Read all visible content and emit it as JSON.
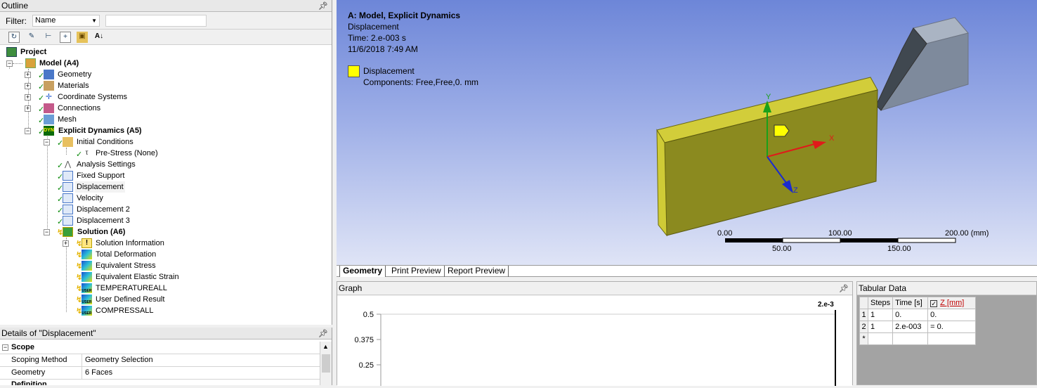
{
  "outline": {
    "title": "Outline",
    "filter_label": "Filter:",
    "filter_value": "Name",
    "filter_text": "",
    "tree": [
      {
        "label": "Project",
        "bold": true
      },
      {
        "label": "Model (A4)",
        "bold": true
      },
      {
        "label": "Geometry"
      },
      {
        "label": "Materials"
      },
      {
        "label": "Coordinate Systems"
      },
      {
        "label": "Connections"
      },
      {
        "label": "Mesh"
      },
      {
        "label": "Explicit Dynamics (A5)",
        "bold": true
      },
      {
        "label": "Initial Conditions"
      },
      {
        "label": "Pre-Stress (None)"
      },
      {
        "label": "Analysis Settings"
      },
      {
        "label": "Fixed Support"
      },
      {
        "label": "Displacement",
        "selected": true
      },
      {
        "label": "Velocity"
      },
      {
        "label": "Displacement 2"
      },
      {
        "label": "Displacement 3"
      },
      {
        "label": "Solution (A6)",
        "bold": true
      },
      {
        "label": "Solution Information"
      },
      {
        "label": "Total Deformation"
      },
      {
        "label": "Equivalent Stress"
      },
      {
        "label": "Equivalent Elastic Strain"
      },
      {
        "label": "TEMPERATUREALL"
      },
      {
        "label": "User Defined Result"
      },
      {
        "label": "COMPRESSALL"
      }
    ],
    "icon_text": {
      "user": "USER",
      "dyn": "DYN"
    }
  },
  "details": {
    "title": "Details of \"Displacement\"",
    "section": "Scope",
    "rows": [
      {
        "key": "Scoping Method",
        "value": "Geometry Selection"
      },
      {
        "key": "Geometry",
        "value": "6 Faces"
      }
    ],
    "next_section": "Definition"
  },
  "viewport": {
    "title": "A: Model, Explicit Dynamics",
    "subtitle": "Displacement",
    "time": "Time: 2.e-003 s",
    "date": "11/6/2018 7:49 AM",
    "legend_label": "Displacement",
    "legend_components": "Components: Free,Free,0. mm",
    "legend_color": "#ffff00",
    "axes": {
      "x": "X",
      "y": "Y",
      "z": "Z"
    },
    "scale_labels": {
      "a": "0.00",
      "b": "100.00",
      "c": "200.00 (mm)",
      "d": "50.00",
      "e": "150.00"
    }
  },
  "tabs": [
    {
      "label": "Geometry",
      "active": true
    },
    {
      "label": "Print Preview"
    },
    {
      "label": "Report Preview"
    }
  ],
  "graph": {
    "title": "Graph",
    "time_marker": "2.e-3",
    "y_ticks": [
      "0.5",
      "0.375",
      "0.25"
    ]
  },
  "tabular": {
    "title": "Tabular Data",
    "headers": [
      "Steps",
      "Time [s]",
      "Z [mm]"
    ],
    "rows": [
      {
        "n": "1",
        "steps": "1",
        "time": "0.",
        "z": "0."
      },
      {
        "n": "2",
        "steps": "1",
        "time": "2.e-003",
        "z": "= 0."
      }
    ],
    "new_row_marker": "*"
  },
  "colors": {
    "body": "#c9c52a",
    "body_dark": "#8c8a1a",
    "tool": "#8695a8",
    "accent": "#0a8a0a"
  }
}
